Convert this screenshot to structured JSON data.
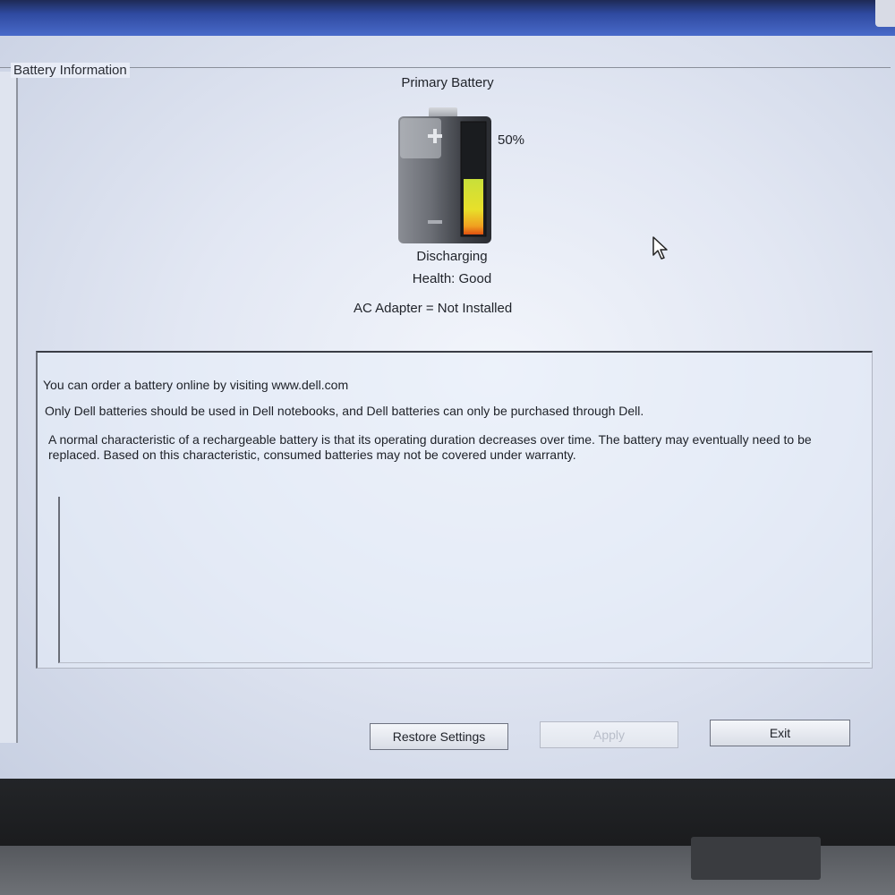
{
  "window": {
    "group_title": "Battery Information"
  },
  "battery": {
    "title": "Primary Battery",
    "percent_label": "50%",
    "charge_level": 0.5,
    "status": "Discharging",
    "health": "Health: Good",
    "ac_adapter": "AC Adapter = Not Installed"
  },
  "info": {
    "line1": "You can order a battery online by visiting www.dell.com",
    "line2": "Only Dell batteries should be used in Dell notebooks, and Dell batteries can only be purchased through Dell.",
    "line3": "A normal characteristic of a rechargeable battery is that its operating duration decreases over time.  The battery may eventually need to be replaced.  Based on this characteristic, consumed batteries may not be covered under warranty."
  },
  "buttons": {
    "restore": "Restore Settings",
    "apply": "Apply",
    "exit": "Exit"
  },
  "icons": {
    "battery": "battery-icon",
    "cursor": "mouse-pointer-icon"
  }
}
